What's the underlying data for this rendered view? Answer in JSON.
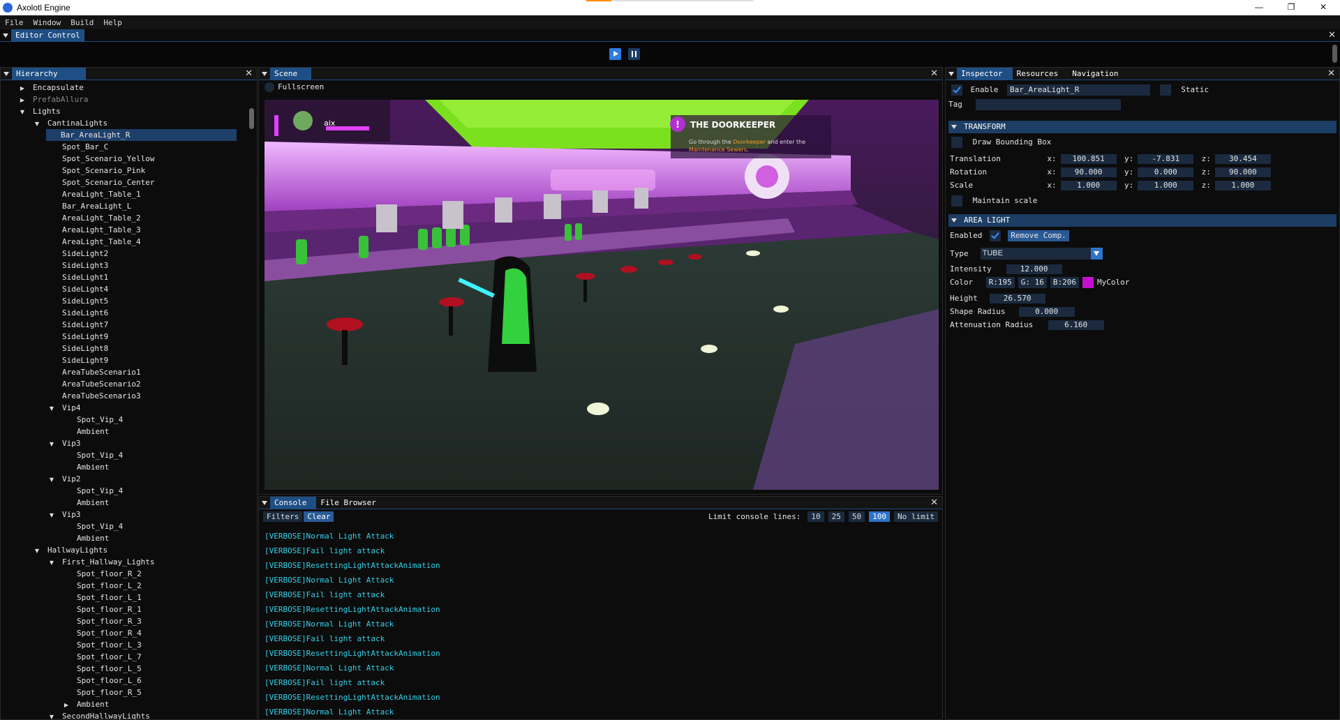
{
  "app": {
    "title": "Axolotl Engine",
    "load_progress": 0.15
  },
  "window_controls": {
    "minimize": "—",
    "maximize": "❐",
    "close": "✕"
  },
  "menu": [
    "File",
    "Window",
    "Build",
    "Help"
  ],
  "editor_control": {
    "tab": "Editor Control",
    "close": "✕"
  },
  "hierarchy": {
    "tab": "Hierarchy",
    "close": "✕",
    "items": [
      {
        "label": "Encapsulate",
        "depth": 1,
        "arrow": "right"
      },
      {
        "label": "PrefabAllura",
        "depth": 1,
        "arrow": "right",
        "dim": true
      },
      {
        "label": "Lights",
        "depth": 1,
        "arrow": "down"
      },
      {
        "label": "CantinaLights",
        "depth": 2,
        "arrow": "down"
      },
      {
        "label": "Bar_AreaLight_R",
        "depth": 3,
        "selected": true
      },
      {
        "label": "Spot_Bar_C",
        "depth": 3
      },
      {
        "label": "Spot_Scenario_Yellow",
        "depth": 3
      },
      {
        "label": "Spot_Scenario_Pink",
        "depth": 3
      },
      {
        "label": "Spot_Scenario_Center",
        "depth": 3
      },
      {
        "label": "AreaLight_Table_1",
        "depth": 3
      },
      {
        "label": "Bar_AreaLight_L",
        "depth": 3
      },
      {
        "label": "AreaLight_Table_2",
        "depth": 3
      },
      {
        "label": "AreaLight_Table_3",
        "depth": 3
      },
      {
        "label": "AreaLight_Table_4",
        "depth": 3
      },
      {
        "label": "SideLight2",
        "depth": 3
      },
      {
        "label": "SideLight3",
        "depth": 3
      },
      {
        "label": "SideLight1",
        "depth": 3
      },
      {
        "label": "SideLight4",
        "depth": 3
      },
      {
        "label": "SideLight5",
        "depth": 3
      },
      {
        "label": "SideLight6",
        "depth": 3
      },
      {
        "label": "SideLight7",
        "depth": 3
      },
      {
        "label": "SideLight9",
        "depth": 3
      },
      {
        "label": "SideLight8",
        "depth": 3
      },
      {
        "label": "SideLight9",
        "depth": 3
      },
      {
        "label": "AreaTubeScenario1",
        "depth": 3
      },
      {
        "label": "AreaTubeScenario2",
        "depth": 3
      },
      {
        "label": "AreaTubeScenario3",
        "depth": 3
      },
      {
        "label": "Vip4",
        "depth": 3,
        "arrow": "down"
      },
      {
        "label": "Spot_Vip_4",
        "depth": 4
      },
      {
        "label": "Ambient",
        "depth": 4
      },
      {
        "label": "Vip3",
        "depth": 3,
        "arrow": "down"
      },
      {
        "label": "Spot_Vip_4",
        "depth": 4
      },
      {
        "label": "Ambient",
        "depth": 4
      },
      {
        "label": "Vip2",
        "depth": 3,
        "arrow": "down"
      },
      {
        "label": "Spot_Vip_4",
        "depth": 4
      },
      {
        "label": "Ambient",
        "depth": 4
      },
      {
        "label": "Vip3",
        "depth": 3,
        "arrow": "down"
      },
      {
        "label": "Spot_Vip_4",
        "depth": 4
      },
      {
        "label": "Ambient",
        "depth": 4
      },
      {
        "label": "HallwayLights",
        "depth": 2,
        "arrow": "down"
      },
      {
        "label": "First_Hallway_Lights",
        "depth": 3,
        "arrow": "down"
      },
      {
        "label": "Spot_floor_R_2",
        "depth": 4
      },
      {
        "label": "Spot_floor_L_2",
        "depth": 4
      },
      {
        "label": "Spot_floor_L_1",
        "depth": 4
      },
      {
        "label": "Spot_floor_R_1",
        "depth": 4
      },
      {
        "label": "Spot_floor_R_3",
        "depth": 4
      },
      {
        "label": "Spot_floor_R_4",
        "depth": 4
      },
      {
        "label": "Spot_floor_L_3",
        "depth": 4
      },
      {
        "label": "Spot_floor_L_7",
        "depth": 4
      },
      {
        "label": "Spot_floor_L_5",
        "depth": 4
      },
      {
        "label": "Spot_floor_L_6",
        "depth": 4
      },
      {
        "label": "Spot_floor_R_5",
        "depth": 4
      },
      {
        "label": "Ambient",
        "depth": 4,
        "arrow": "right"
      },
      {
        "label": "SecondHallwayLights",
        "depth": 3,
        "arrow": "down"
      }
    ]
  },
  "scene": {
    "tab": "Scene",
    "close": "✕",
    "fullscreen_label": "Fullscreen",
    "game_hud": {
      "player_name": "aix",
      "quest_title": "THE DOORKEEPER",
      "quest_text_1": "Go through the ",
      "quest_highlight_1": "Doorkeeper",
      "quest_text_2": " and enter the",
      "quest_highlight_2": "Maintenance Sewers",
      "quest_text_3": "."
    }
  },
  "console": {
    "tabs": [
      "Console",
      "File Browser"
    ],
    "close": "✕",
    "filters": "Filters",
    "clear": "Clear",
    "limit_label": "Limit console lines:",
    "limits": [
      "10",
      "25",
      "50",
      "100",
      "No limit"
    ],
    "active_limit": "100",
    "lines": [
      "[VERBOSE]Normal Light Attack",
      "[VERBOSE]Fail light attack",
      "[VERBOSE]ResettingLightAttackAnimation",
      "[VERBOSE]Normal Light Attack",
      "[VERBOSE]Fail light attack",
      "[VERBOSE]ResettingLightAttackAnimation",
      "[VERBOSE]Normal Light Attack",
      "[VERBOSE]Fail light attack",
      "[VERBOSE]ResettingLightAttackAnimation",
      "[VERBOSE]Normal Light Attack",
      "[VERBOSE]Fail light attack",
      "[VERBOSE]ResettingLightAttackAnimation",
      "[VERBOSE]Normal Light Attack"
    ]
  },
  "inspector": {
    "tabs": [
      "Inspector",
      "Resources",
      "Navigation"
    ],
    "close": "✕",
    "enable_label": "Enable",
    "enabled": true,
    "name": "Bar_AreaLight_R",
    "static_label": "Static",
    "tag_label": "Tag",
    "tag_value": "",
    "transform": {
      "header": "TRANSFORM",
      "draw_bbox_label": "Draw Bounding Box",
      "translation_label": "Translation",
      "rotation_label": "Rotation",
      "scale_label": "Scale",
      "maintain_scale_label": "Maintain scale",
      "x": "x:",
      "y": "y:",
      "z": "z:",
      "translation": [
        "100.851",
        "-7.831",
        "30.454"
      ],
      "rotation": [
        "90.000",
        "0.000",
        "90.000"
      ],
      "scale": [
        "1.000",
        "1.000",
        "1.000"
      ]
    },
    "area_light": {
      "header": "AREA LIGHT",
      "enabled_label": "Enabled",
      "remove_button": "Remove Comp.",
      "type_label": "Type",
      "type_value": "TUBE",
      "intensity_label": "Intensity",
      "intensity": "12.000",
      "color_label": "Color",
      "r": "R:195",
      "g": "G: 16",
      "b": "B:206",
      "color_hex": "#c310ce",
      "color_name": "MyColor",
      "height_label": "Height",
      "height": "26.570",
      "shape_radius_label": "Shape Radius",
      "shape_radius": "0.000",
      "attenuation_label": "Attenuation Radius",
      "attenuation": "6.160"
    }
  },
  "colors": {
    "accent": "#1f4e84",
    "button": "#2e73c9",
    "log": "#35d0e8"
  }
}
